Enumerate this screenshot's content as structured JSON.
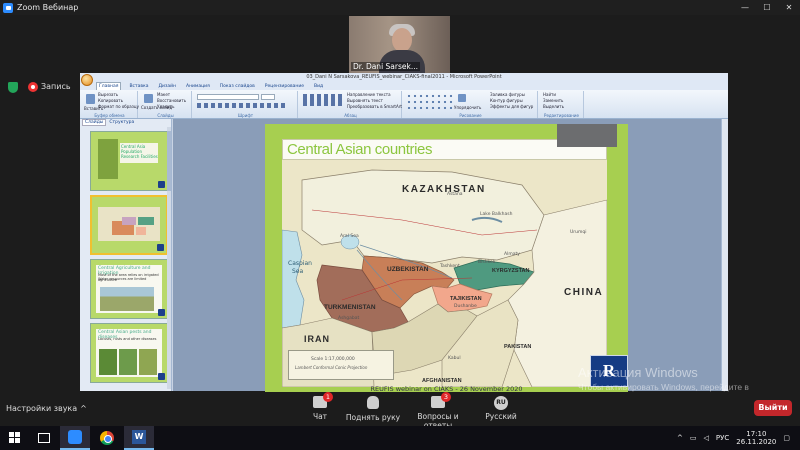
{
  "zoom": {
    "window_title": "Zoom Вебинар",
    "participant_name": "Dr. Dani Sarsek...",
    "record_label": "Запись",
    "sound_settings": "Настройки звука",
    "toolbar": {
      "chat": "Чат",
      "chat_badge": "1",
      "raise_hand": "Поднять руку",
      "qa": "Вопросы и ответы",
      "qa_badge": "3",
      "language_code": "RU",
      "language": "Русский",
      "leave": "Выйти"
    },
    "colors": {
      "leave": "#c3272b",
      "badge": "#e02828",
      "accent": "#2d8cff"
    }
  },
  "powerpoint": {
    "window_title": "03_Dani N Sarsakova_REUFIS_webinar_CIAKS-final2011 - Microsoft PowerPoint",
    "tabs": [
      "Главная",
      "Вставка",
      "Дизайн",
      "Анимация",
      "Показ слайдов",
      "Рецензирование",
      "Вид"
    ],
    "ribbon": {
      "clipboard": {
        "paste": "Вставить",
        "cut": "Вырезать",
        "copy": "Копировать",
        "format_painter": "Формат по образцу",
        "label": "Буфер обмена"
      },
      "slides": {
        "new_slide": "Создать слайд",
        "layout": "Макет",
        "reset": "Восстановить",
        "delete": "Удалить",
        "label": "Слайды"
      },
      "font_label": "Шрифт",
      "paragraph": {
        "direction": "Направление текста",
        "align": "Выровнять текст",
        "smartart": "Преобразовать в SmartArt",
        "label": "Абзац"
      },
      "drawing": {
        "arrange": "Упорядочить",
        "quick_styles": "Экспресс-стили",
        "shape_fill": "Заливка фигуры",
        "shape_outline": "Контур фигуры",
        "shape_effects": "Эффекты для фигур",
        "label": "Рисование"
      },
      "editing": {
        "find": "Найти",
        "replace": "Заменить",
        "select": "Выделить",
        "label": "Редактирование"
      }
    },
    "pane_tabs": [
      "Слайды",
      "Структура"
    ],
    "thumbnails": [
      {
        "num": "1",
        "lines": [
          "Central Asia",
          "Population",
          "Research Facilities"
        ]
      },
      {
        "num": "2",
        "lines": []
      },
      {
        "num": "3",
        "heading": "Central Agriculture and Irrigation",
        "lines": [
          "Most of the area relies on irrigated agriculture",
          "Water resources are limited",
          "Main river basins: Amu Darya, Syr Darya"
        ]
      },
      {
        "num": "4",
        "heading": "Central Asian pests and diseases",
        "lines": [
          "Locusts, rusts and other diseases"
        ]
      }
    ]
  },
  "slide": {
    "title": "Central Asian countries",
    "footer": "REUFIS webinar on CIAKS - 26 November 2020",
    "logo_letter": "R",
    "map": {
      "countries": {
        "kazakhstan": "KAZAKHSTAN",
        "uzbekistan": "UZBEKISTAN",
        "turkmenistan": "TURKMENISTAN",
        "kyrgyzstan": "KYRGYZSTAN",
        "tajikistan": "TAJIKISTAN",
        "china": "CHINA",
        "iran": "IRAN",
        "afghanistan": "AFGHANISTAN",
        "pakistan": "PAKISTAN"
      },
      "seas": {
        "caspian": "Caspian",
        "caspian2": "Sea"
      },
      "cities": [
        "Astana",
        "Almaty",
        "Bishkek",
        "Tashkent",
        "Dushanbe",
        "Ashgabat",
        "Kabul",
        "Urumqi",
        "Aral Sea",
        "Lake Balkhash"
      ],
      "scale": "Scale 1:17,000,000",
      "projection": "Lambert Conformal Conic Projection"
    }
  },
  "windows": {
    "activate_title": "Активация Windows",
    "activate_text": "Чтобы активировать Windows, перейдите в раздел \"Параметры\".",
    "lang": "РУС",
    "time": "17:10",
    "date": "26.11.2020"
  }
}
